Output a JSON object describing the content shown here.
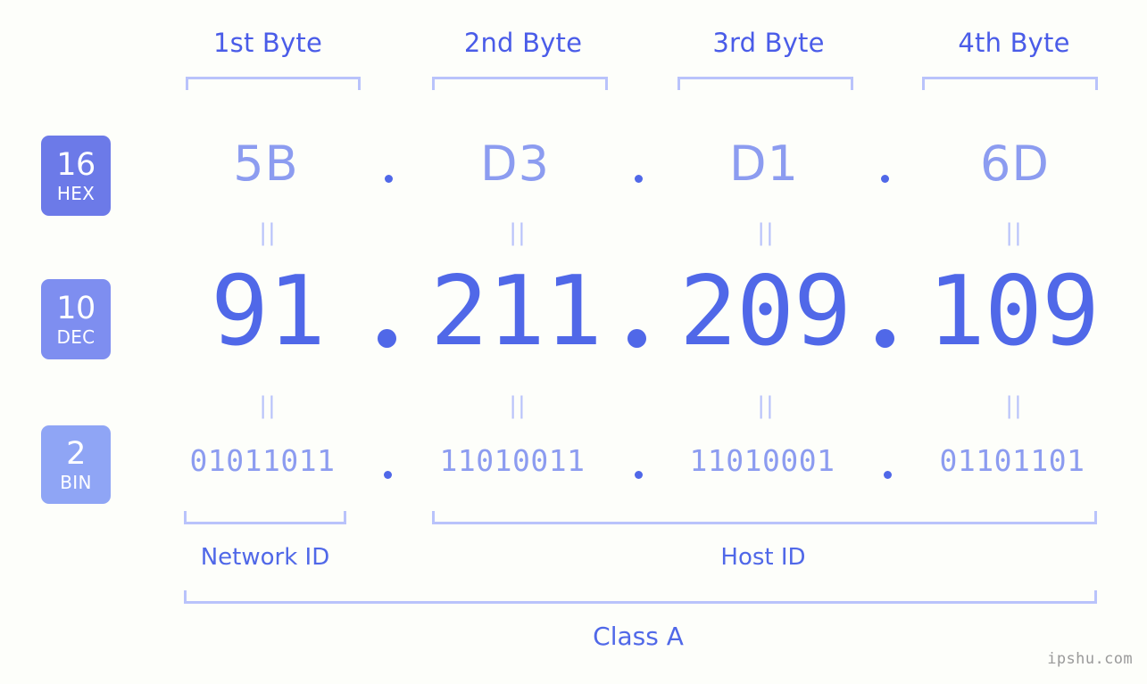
{
  "meta": {
    "watermark": "ipshu.com"
  },
  "header": {
    "byte_labels": [
      "1st Byte",
      "2nd Byte",
      "3rd Byte",
      "4th Byte"
    ]
  },
  "rows": {
    "hex": {
      "base": "16",
      "tag": "HEX",
      "values": [
        "5B",
        "D3",
        "D1",
        "6D"
      ],
      "separator": "."
    },
    "dec": {
      "base": "10",
      "tag": "DEC",
      "values": [
        "91",
        "211",
        "209",
        "109"
      ],
      "separator": "."
    },
    "bin": {
      "base": "2",
      "tag": "BIN",
      "values": [
        "01011011",
        "11010011",
        "11010001",
        "01101101"
      ],
      "separator": "."
    }
  },
  "equality": {
    "symbol": "||",
    "hex_to_dec": [
      "||",
      "||",
      "||",
      "||"
    ],
    "dec_to_bin": [
      "||",
      "||",
      "||",
      "||"
    ]
  },
  "footer": {
    "network_id_label": "Network ID",
    "host_id_label": "Host ID",
    "class_label": "Class A"
  },
  "colors": {
    "background": "#fdfefa",
    "badge_hex": "#6c7ae8",
    "badge_dec": "#7e8ef0",
    "badge_bin": "#8fa5f5",
    "accent_strong": "#5068e8",
    "accent_light": "#8c9cf0",
    "bracket": "#b9c3fb",
    "header_label": "#4a5ce8",
    "watermark": "#9a9a9a"
  }
}
